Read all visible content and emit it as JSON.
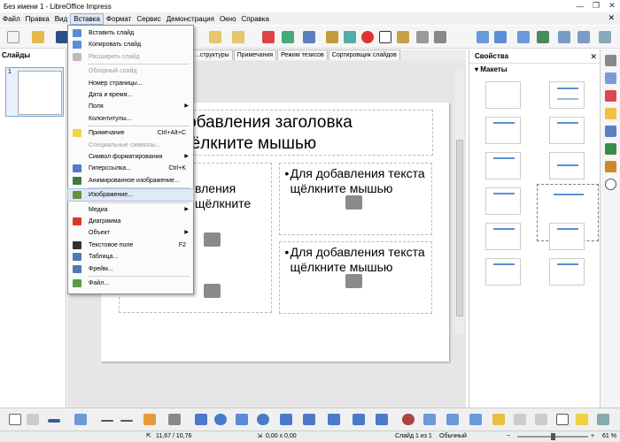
{
  "window": {
    "title": "Без имени 1 - LibreOffice Impress"
  },
  "menu": [
    "Файл",
    "Правка",
    "Вид",
    "Вставка",
    "Формат",
    "Сервис",
    "Демонстрация",
    "Окно",
    "Справка"
  ],
  "active_menu": "Вставка",
  "panes": {
    "slides_title": "Слайды",
    "slide_number": "1"
  },
  "view_tabs": [
    "...структуры",
    "Примечания",
    "Режим тезисов",
    "Сортировщик слайдов"
  ],
  "slide": {
    "title_text": "Для добавления заголовка щёлкните мышью",
    "title_visible": "добавления заголовка\nщёлкните мышью",
    "left_text": "Для добавления текста щёлкните",
    "left_visible": "вления\nщёлкните",
    "body1": "Для добавления текста щёлкните мышью",
    "body2": "Для добавления текста щёлкните мышью"
  },
  "insert_menu": {
    "items": [
      {
        "label": "Вставить слайд",
        "shortcut": "",
        "disabled": false,
        "submenu": false,
        "icon_color": "#5a8fd6"
      },
      {
        "label": "Копировать слайд",
        "shortcut": "",
        "disabled": false,
        "submenu": false,
        "icon_color": "#5a8fd6"
      },
      {
        "label": "Расширить слайд",
        "shortcut": "",
        "disabled": true,
        "submenu": false,
        "icon_color": "#bbbbbb"
      },
      {
        "label": "Обзорный слайд",
        "shortcut": "",
        "disabled": true,
        "submenu": false,
        "icon_color": ""
      },
      {
        "label": "Номер страницы...",
        "shortcut": "",
        "disabled": false,
        "submenu": false,
        "icon_color": ""
      },
      {
        "label": "Дата и время...",
        "shortcut": "",
        "disabled": false,
        "submenu": false,
        "icon_color": ""
      },
      {
        "label": "Поля",
        "shortcut": "",
        "disabled": false,
        "submenu": true,
        "icon_color": ""
      },
      {
        "label": "Колонтитулы...",
        "shortcut": "",
        "disabled": false,
        "submenu": false,
        "icon_color": ""
      },
      {
        "label": "Примечание",
        "shortcut": "Ctrl+Alt+C",
        "disabled": false,
        "submenu": false,
        "icon_color": "#f1d34a"
      },
      {
        "label": "Специальные символы...",
        "shortcut": "",
        "disabled": true,
        "submenu": false,
        "icon_color": ""
      },
      {
        "label": "Символ форматирования",
        "shortcut": "",
        "disabled": false,
        "submenu": true,
        "icon_color": ""
      },
      {
        "label": "Гиперссылка...",
        "shortcut": "Ctrl+K",
        "disabled": false,
        "submenu": false,
        "icon_color": "#4d7fc9"
      },
      {
        "label": "Анимированное изображение...",
        "shortcut": "",
        "disabled": false,
        "submenu": false,
        "icon_color": "#3d7a3d"
      },
      {
        "label": "Изображение...",
        "shortcut": "",
        "disabled": false,
        "submenu": false,
        "icon_color": "#6b8e3a",
        "highlight": true
      },
      {
        "label": "Медиа",
        "shortcut": "",
        "disabled": false,
        "submenu": true,
        "icon_color": ""
      },
      {
        "label": "Диаграмма",
        "shortcut": "",
        "disabled": false,
        "submenu": false,
        "icon_color": "#d33a2c"
      },
      {
        "label": "Объект",
        "shortcut": "",
        "disabled": false,
        "submenu": true,
        "icon_color": ""
      },
      {
        "label": "Текстовое поле",
        "shortcut": "F2",
        "disabled": false,
        "submenu": false,
        "icon_color": "#333333"
      },
      {
        "label": "Таблица...",
        "shortcut": "",
        "disabled": false,
        "submenu": false,
        "icon_color": "#4f7ab8"
      },
      {
        "label": "Фрейм...",
        "shortcut": "",
        "disabled": false,
        "submenu": false,
        "icon_color": "#4f7ab8"
      },
      {
        "label": "Файл...",
        "shortcut": "",
        "disabled": false,
        "submenu": false,
        "icon_color": "#5a9a4a"
      }
    ]
  },
  "properties": {
    "title": "Свойства",
    "section": "Макеты"
  },
  "status": {
    "position": "11,67 / 10,76",
    "size": "0,00 x 0,00",
    "slide": "Слайд 1 из 1",
    "layout": "Обычный",
    "zoom": "61 %"
  }
}
